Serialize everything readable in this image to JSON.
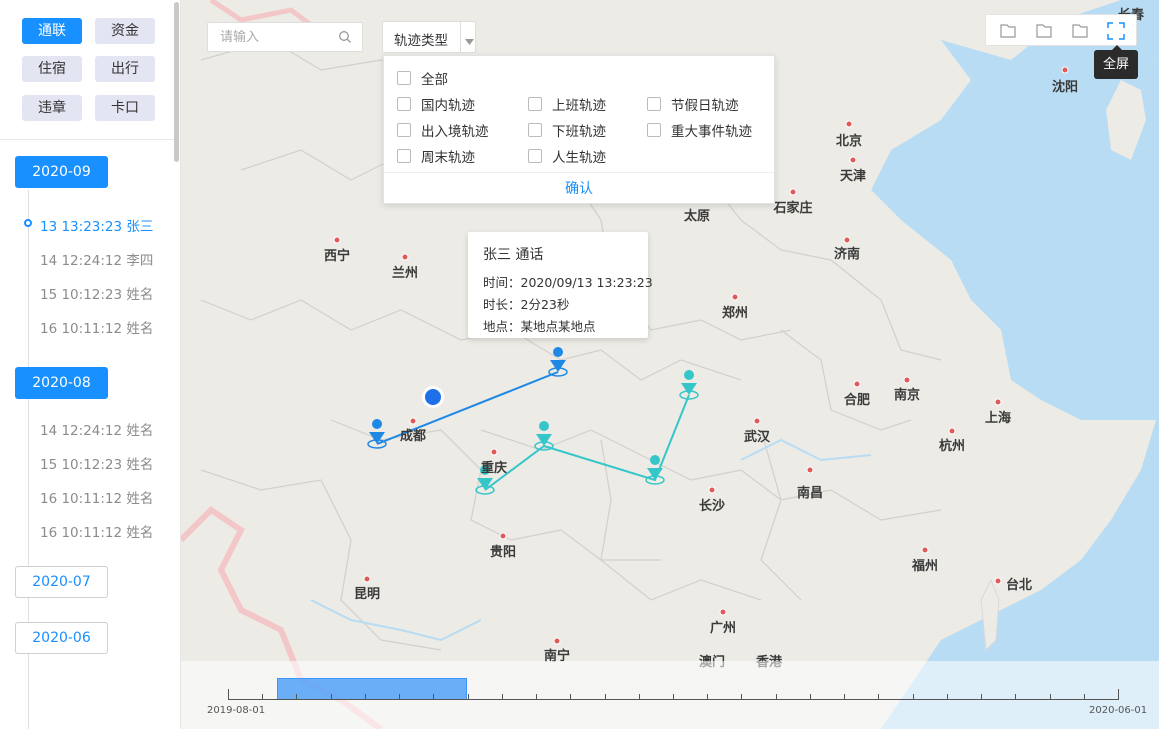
{
  "sidebar": {
    "categories": [
      {
        "label": "通联",
        "active": true
      },
      {
        "label": "资金",
        "active": false
      },
      {
        "label": "住宿",
        "active": false
      },
      {
        "label": "出行",
        "active": false
      },
      {
        "label": "违章",
        "active": false
      },
      {
        "label": "卡口",
        "active": false
      }
    ],
    "groups": [
      {
        "month": "2020-09",
        "active": true,
        "records": [
          {
            "text": "13 13:23:23 张三",
            "active": true
          },
          {
            "text": "14 12:24:12 李四",
            "active": false
          },
          {
            "text": "15 10:12:23 姓名",
            "active": false
          },
          {
            "text": "16 10:11:12 姓名",
            "active": false
          }
        ]
      },
      {
        "month": "2020-08",
        "active": true,
        "records": [
          {
            "text": "14 12:24:12 姓名",
            "active": false
          },
          {
            "text": "15 10:12:23 姓名",
            "active": false
          },
          {
            "text": "16 10:11:12 姓名",
            "active": false
          },
          {
            "text": "16 10:11:12 姓名",
            "active": false
          }
        ]
      },
      {
        "month": "2020-07",
        "active": false,
        "records": []
      },
      {
        "month": "2020-06",
        "active": false,
        "records": []
      }
    ]
  },
  "search": {
    "placeholder": "请输入"
  },
  "trajectory_select": {
    "label": "轨迹类型",
    "options": [
      "全部",
      "国内轨迹",
      "上班轨迹",
      "节假日轨迹",
      "出入境轨迹",
      "下班轨迹",
      "重大事件轨迹",
      "周末轨迹",
      "人生轨迹"
    ],
    "confirm": "确认"
  },
  "toolbar": {
    "fullscreen_tooltip": "全屏"
  },
  "info_popup": {
    "title": "张三 通话",
    "time": "时间：2020/09/13 13:23:23",
    "duration": "时长：2分23秒",
    "location": "地点：某地点某地点"
  },
  "cities": [
    "沈阳",
    "北京",
    "天津",
    "太原",
    "石家庄",
    "西宁",
    "兰州",
    "济南",
    "郑州",
    "合肥",
    "南京",
    "上海",
    "成都",
    "武汉",
    "杭州",
    "重庆",
    "长沙",
    "南昌",
    "贵阳",
    "福州",
    "昆明",
    "台北",
    "广州",
    "南宁",
    "澳门",
    "香港",
    "长春"
  ],
  "timeline": {
    "start": "2019-08-01",
    "end": "2020-06-01"
  },
  "colors": {
    "primary": "#1890ff",
    "track_a": "#1e88e5",
    "track_b": "#35c6c9"
  }
}
